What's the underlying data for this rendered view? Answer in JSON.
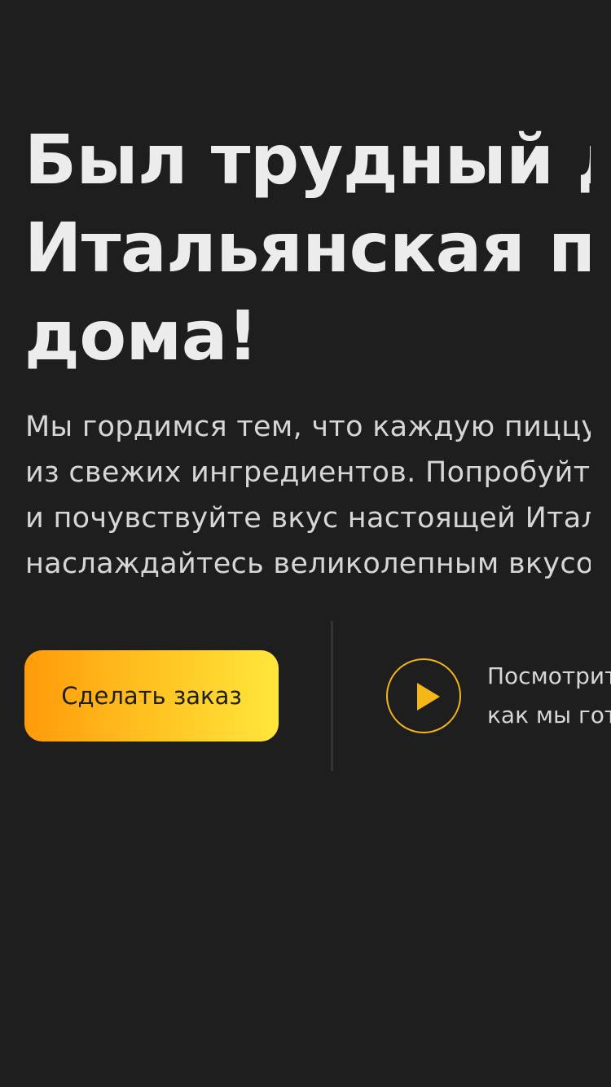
{
  "hero": {
    "headline_lines": [
      "Был трудный день?",
      "Итальянская пицца",
      "дома!"
    ],
    "description_lines": [
      "Мы гордимся тем, что каждую пиццу",
      "из свежих ингредиентов. Попробуйте",
      "и почувствуйте вкус настоящей Италии",
      "наслаждайтесь великолепным вкусом"
    ],
    "order_button_label": "Сделать заказ",
    "video_lines": [
      "Посмотрите видео,",
      "как мы готовим"
    ]
  },
  "colors": {
    "background": "#1e1e1e",
    "accent_start": "#ff9a0a",
    "accent_end": "#ffe63a",
    "play_accent": "#f5b617",
    "text_primary": "#ececec",
    "text_secondary": "#d6d6d6"
  },
  "icons": {
    "play": "play-icon"
  }
}
